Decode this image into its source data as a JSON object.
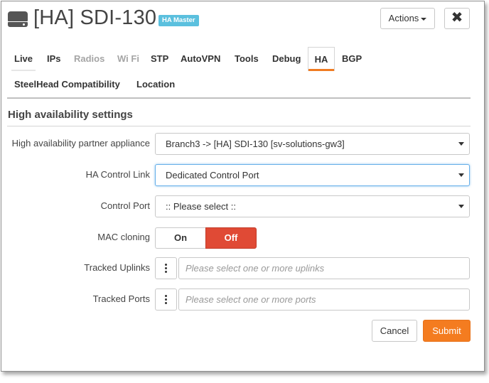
{
  "header": {
    "icon": "device-icon",
    "title": "[HA] SDI-130",
    "badge": "HA Master",
    "actions_label": "Actions",
    "close_label": "✖"
  },
  "tabs": [
    {
      "label": "Live",
      "state": "normal"
    },
    {
      "label": "IPs",
      "state": "normal"
    },
    {
      "label": "Radios",
      "state": "disabled"
    },
    {
      "label": "Wi Fi",
      "state": "disabled"
    },
    {
      "label": "STP",
      "state": "normal"
    },
    {
      "label": "AutoVPN",
      "state": "normal"
    },
    {
      "label": "Tools",
      "state": "normal"
    },
    {
      "label": "Debug",
      "state": "normal"
    },
    {
      "label": "HA",
      "state": "active"
    },
    {
      "label": "BGP",
      "state": "normal"
    },
    {
      "label": "SteelHead Compatibility",
      "state": "normal"
    },
    {
      "label": "Location",
      "state": "normal"
    }
  ],
  "section": {
    "title": "High availability settings"
  },
  "form": {
    "partner": {
      "label": "High availability partner appliance",
      "value": "Branch3 -> [HA] SDI-130 [sv-solutions-gw3]"
    },
    "control_link": {
      "label": "HA Control Link",
      "value": "Dedicated Control Port"
    },
    "control_port": {
      "label": "Control Port",
      "value": ":: Please select ::"
    },
    "mac_cloning": {
      "label": "MAC cloning",
      "on_label": "On",
      "off_label": "Off",
      "selected": "Off"
    },
    "tracked_uplinks": {
      "label": "Tracked Uplinks",
      "placeholder": "Please select one or more uplinks"
    },
    "tracked_ports": {
      "label": "Tracked Ports",
      "placeholder": "Please select one or more ports"
    }
  },
  "buttons": {
    "cancel": "Cancel",
    "submit": "Submit"
  },
  "colors": {
    "accent": "#f47c20",
    "off_toggle": "#e04a35",
    "badge": "#5bc0de",
    "focus": "#66afe9"
  }
}
